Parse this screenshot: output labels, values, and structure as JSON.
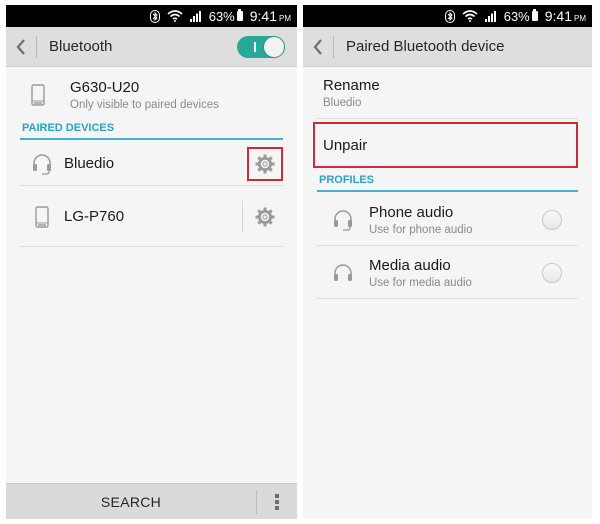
{
  "status_bar": {
    "icons": [
      "bluetooth-icon",
      "wifi-icon",
      "signal-icon",
      "battery-icon"
    ],
    "battery": "63%",
    "time": "9:41",
    "ampm": "PM"
  },
  "left": {
    "action_bar": {
      "back_icon": "chevron-left-icon",
      "title": "Bluetooth",
      "toggle_on": true
    },
    "this_device": {
      "icon": "phone-icon",
      "name": "G630-U20",
      "subtitle": "Only visible to paired devices"
    },
    "paired_header": "PAIRED DEVICES",
    "paired_devices": [
      {
        "icon": "headset-icon",
        "name": "Bluedio",
        "action_icon": "gear-icon",
        "highlighted": true
      },
      {
        "icon": "phone-icon",
        "name": "LG-P760",
        "action_icon": "gear-icon",
        "highlighted": false
      }
    ],
    "bottom_bar": {
      "search_label": "SEARCH",
      "more_icon": "more-vert-icon"
    }
  },
  "right": {
    "action_bar": {
      "back_icon": "chevron-left-icon",
      "title": "Paired Bluetooth device"
    },
    "rename": {
      "label": "Rename",
      "value": "Bluedio"
    },
    "unpair": {
      "label": "Unpair",
      "highlighted": true
    },
    "profiles_header": "PROFILES",
    "profiles": [
      {
        "icon": "headset-mic-icon",
        "name": "Phone audio",
        "subtitle": "Use for phone audio",
        "checked": false
      },
      {
        "icon": "headphones-icon",
        "name": "Media audio",
        "subtitle": "Use for media audio",
        "checked": false
      }
    ]
  },
  "colors": {
    "accent": "#29a99b",
    "section_header": "#2aa3c0",
    "highlight_box": "#d02a3a"
  }
}
